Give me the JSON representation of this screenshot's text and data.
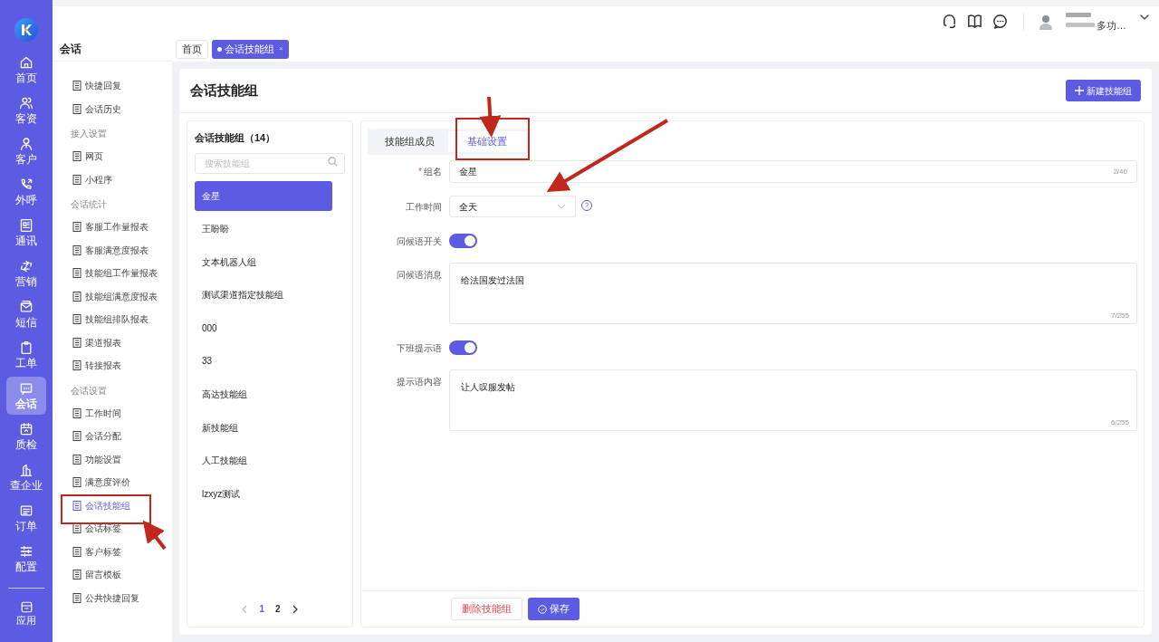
{
  "nav": {
    "items": [
      {
        "label": "首页",
        "selected": false
      },
      {
        "label": "客资",
        "selected": false
      },
      {
        "label": "客户",
        "selected": false
      },
      {
        "label": "外呼",
        "selected": false
      },
      {
        "label": "通讯",
        "selected": false
      },
      {
        "label": "营销",
        "selected": false
      },
      {
        "label": "短信",
        "selected": false
      },
      {
        "label": "工单",
        "selected": false
      },
      {
        "label": "会话",
        "selected": true
      },
      {
        "label": "质检",
        "selected": false
      },
      {
        "label": "查企业",
        "selected": false
      },
      {
        "label": "订单",
        "selected": false
      },
      {
        "label": "配置",
        "selected": false
      }
    ],
    "bottom": {
      "label": "应用"
    }
  },
  "header": {
    "user_role": "多功…"
  },
  "submenu": {
    "title": "会话",
    "groups": [
      {
        "items": [
          {
            "label": "快捷回复",
            "selected": false
          },
          {
            "label": "会话历史",
            "selected": false
          }
        ]
      },
      {
        "title": "接入设置",
        "items": [
          {
            "label": "网页",
            "selected": false
          },
          {
            "label": "小程序",
            "selected": false
          }
        ]
      },
      {
        "title": "会话统计",
        "items": [
          {
            "label": "客服工作量报表",
            "selected": false
          },
          {
            "label": "客服满意度报表",
            "selected": false
          },
          {
            "label": "技能组工作量报表",
            "selected": false
          },
          {
            "label": "技能组满意度报表",
            "selected": false
          },
          {
            "label": "技能组排队报表",
            "selected": false
          },
          {
            "label": "渠道报表",
            "selected": false
          },
          {
            "label": "转接报表",
            "selected": false
          }
        ]
      },
      {
        "title": "会话设置",
        "items": [
          {
            "label": "工作时间",
            "selected": false
          },
          {
            "label": "会话分配",
            "selected": false
          },
          {
            "label": "功能设置",
            "selected": false
          },
          {
            "label": "满意度评价",
            "selected": false
          },
          {
            "label": "会话技能组",
            "selected": true
          },
          {
            "label": "会话标签",
            "selected": false
          },
          {
            "label": "客户标签",
            "selected": false
          },
          {
            "label": "留言模板",
            "selected": false
          },
          {
            "label": "公共快捷回复",
            "selected": false
          }
        ]
      }
    ]
  },
  "tabs": [
    {
      "label": "首页",
      "selected": false
    },
    {
      "label": "会话技能组",
      "selected": true,
      "close": "×"
    }
  ],
  "page": {
    "title": "会话技能组",
    "new_button": "新建技能组"
  },
  "group_list": {
    "title": "会话技能组（14）",
    "search": {
      "placeholder": "搜索技能组"
    },
    "items": [
      {
        "label": "金星",
        "selected": true
      },
      {
        "label": "王盼盼",
        "selected": false
      },
      {
        "label": "文本机器人组",
        "selected": false
      },
      {
        "label": "测试渠道指定技能组",
        "selected": false
      },
      {
        "label": "000",
        "selected": false
      },
      {
        "label": "33",
        "selected": false
      },
      {
        "label": "高达技能组",
        "selected": false
      },
      {
        "label": "新技能组",
        "selected": false
      },
      {
        "label": "人工技能组",
        "selected": false
      },
      {
        "label": "lzxyz测试",
        "selected": false
      }
    ],
    "pagination": {
      "pages": [
        {
          "label": "1",
          "selected": true
        },
        {
          "label": "2",
          "selected": false
        }
      ]
    }
  },
  "detail": {
    "tabs": [
      {
        "label": "技能组成员",
        "selected": false
      },
      {
        "label": "基础设置",
        "selected": true
      }
    ],
    "fields": [
      {
        "kind": "text",
        "label": "组名",
        "required_mark": "*",
        "value": "金星",
        "counter": "2/40"
      },
      {
        "kind": "select",
        "label": "工作时间",
        "value": "全天",
        "help": "?"
      },
      {
        "kind": "switch",
        "label": "问候语开关",
        "on": true
      },
      {
        "kind": "textarea",
        "label": "问候语消息",
        "value": "给法国发过法国",
        "counter": "7/255"
      },
      {
        "kind": "switch",
        "label": "下班提示语",
        "on": true
      },
      {
        "kind": "textarea",
        "label": "提示语内容",
        "value": "让人叹服发帖",
        "counter": "6/255"
      }
    ],
    "delete_button": "删除技能组",
    "save_button": "保存"
  }
}
